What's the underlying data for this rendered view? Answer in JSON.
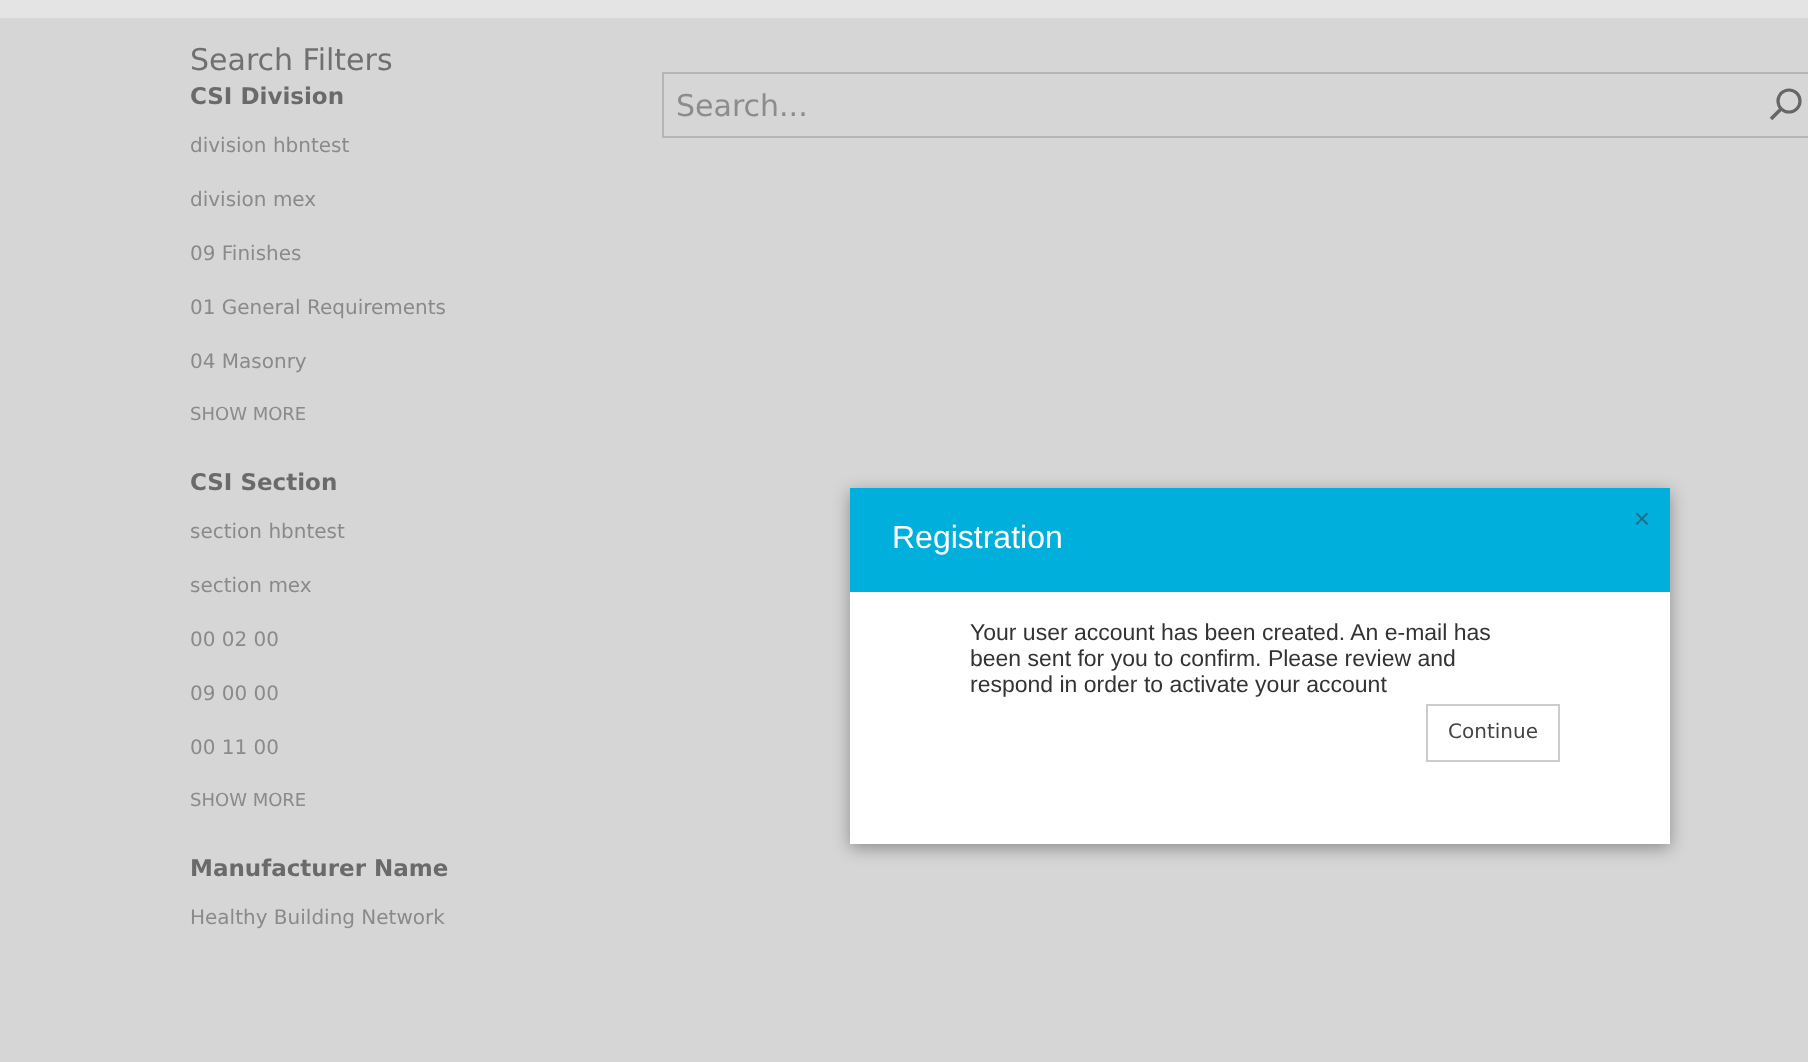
{
  "sidebar": {
    "title": "Search Filters",
    "groups": [
      {
        "heading": "CSI Division",
        "items": [
          "division hbntest",
          "division mex",
          "09 Finishes",
          "01 General Requirements",
          "04 Masonry"
        ],
        "show_more": "SHOW MORE"
      },
      {
        "heading": "CSI Section",
        "items": [
          "section hbntest",
          "section mex",
          "00 02 00",
          "09 00 00",
          "00 11 00"
        ],
        "show_more": "SHOW MORE"
      },
      {
        "heading": "Manufacturer Name",
        "items": [
          "Healthy Building Network"
        ]
      }
    ]
  },
  "search": {
    "placeholder": "Search..."
  },
  "dialog": {
    "title": "Registration",
    "close": "×",
    "message": "Your user account has been created. An e-mail has been sent for you to confirm. Please review and respond in order to activate your account",
    "button": "Continue"
  }
}
